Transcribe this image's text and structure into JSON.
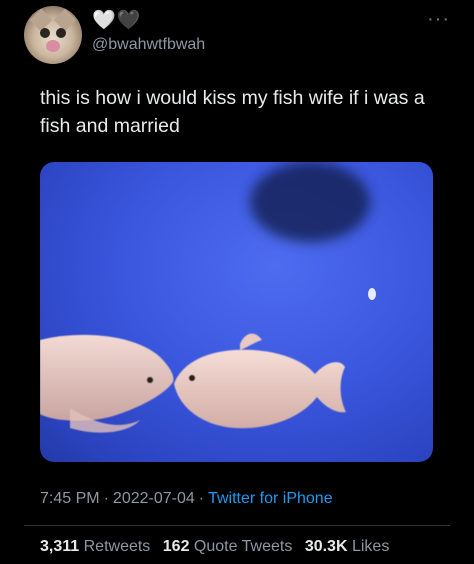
{
  "user": {
    "handle": "@bwahwtfbwah",
    "hearts": [
      "🤍",
      "🖤"
    ]
  },
  "more_icon": "more-horizontal-icon",
  "tweet": {
    "text": "this is how i would kiss my fish wife if i was a fish and married"
  },
  "media": {
    "type": "video-still",
    "colors": {
      "water": "#3b57de",
      "fish": "#e9c8c0"
    }
  },
  "meta": {
    "time": "7:45 PM",
    "separator": "·",
    "date": "2022-07-04",
    "source": "Twitter for iPhone"
  },
  "stats": {
    "retweets_count": "3,311",
    "retweets_label": "Retweets",
    "quotes_count": "162",
    "quotes_label": "Quote Tweets",
    "likes_count": "30.3K",
    "likes_label": "Likes"
  },
  "colors": {
    "background": "#000000",
    "text": "#e7e9ea",
    "muted": "#8b98a5",
    "link": "#1d9bf0"
  }
}
